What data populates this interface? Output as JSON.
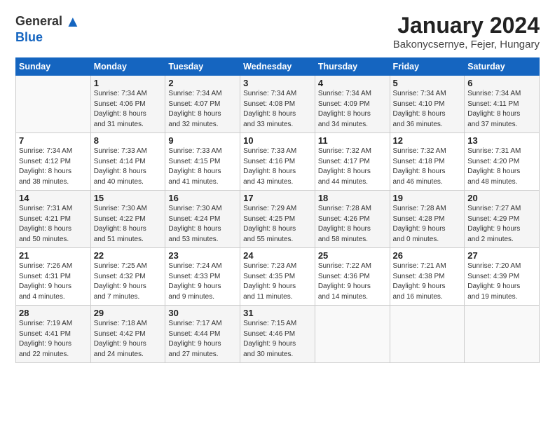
{
  "logo": {
    "general": "General",
    "blue": "Blue"
  },
  "header": {
    "month": "January 2024",
    "location": "Bakonycsernye, Fejer, Hungary"
  },
  "weekdays": [
    "Sunday",
    "Monday",
    "Tuesday",
    "Wednesday",
    "Thursday",
    "Friday",
    "Saturday"
  ],
  "weeks": [
    [
      {
        "day": "",
        "info": ""
      },
      {
        "day": "1",
        "info": "Sunrise: 7:34 AM\nSunset: 4:06 PM\nDaylight: 8 hours\nand 31 minutes."
      },
      {
        "day": "2",
        "info": "Sunrise: 7:34 AM\nSunset: 4:07 PM\nDaylight: 8 hours\nand 32 minutes."
      },
      {
        "day": "3",
        "info": "Sunrise: 7:34 AM\nSunset: 4:08 PM\nDaylight: 8 hours\nand 33 minutes."
      },
      {
        "day": "4",
        "info": "Sunrise: 7:34 AM\nSunset: 4:09 PM\nDaylight: 8 hours\nand 34 minutes."
      },
      {
        "day": "5",
        "info": "Sunrise: 7:34 AM\nSunset: 4:10 PM\nDaylight: 8 hours\nand 36 minutes."
      },
      {
        "day": "6",
        "info": "Sunrise: 7:34 AM\nSunset: 4:11 PM\nDaylight: 8 hours\nand 37 minutes."
      }
    ],
    [
      {
        "day": "7",
        "info": "Sunrise: 7:34 AM\nSunset: 4:12 PM\nDaylight: 8 hours\nand 38 minutes."
      },
      {
        "day": "8",
        "info": "Sunrise: 7:33 AM\nSunset: 4:14 PM\nDaylight: 8 hours\nand 40 minutes."
      },
      {
        "day": "9",
        "info": "Sunrise: 7:33 AM\nSunset: 4:15 PM\nDaylight: 8 hours\nand 41 minutes."
      },
      {
        "day": "10",
        "info": "Sunrise: 7:33 AM\nSunset: 4:16 PM\nDaylight: 8 hours\nand 43 minutes."
      },
      {
        "day": "11",
        "info": "Sunrise: 7:32 AM\nSunset: 4:17 PM\nDaylight: 8 hours\nand 44 minutes."
      },
      {
        "day": "12",
        "info": "Sunrise: 7:32 AM\nSunset: 4:18 PM\nDaylight: 8 hours\nand 46 minutes."
      },
      {
        "day": "13",
        "info": "Sunrise: 7:31 AM\nSunset: 4:20 PM\nDaylight: 8 hours\nand 48 minutes."
      }
    ],
    [
      {
        "day": "14",
        "info": "Sunrise: 7:31 AM\nSunset: 4:21 PM\nDaylight: 8 hours\nand 50 minutes."
      },
      {
        "day": "15",
        "info": "Sunrise: 7:30 AM\nSunset: 4:22 PM\nDaylight: 8 hours\nand 51 minutes."
      },
      {
        "day": "16",
        "info": "Sunrise: 7:30 AM\nSunset: 4:24 PM\nDaylight: 8 hours\nand 53 minutes."
      },
      {
        "day": "17",
        "info": "Sunrise: 7:29 AM\nSunset: 4:25 PM\nDaylight: 8 hours\nand 55 minutes."
      },
      {
        "day": "18",
        "info": "Sunrise: 7:28 AM\nSunset: 4:26 PM\nDaylight: 8 hours\nand 58 minutes."
      },
      {
        "day": "19",
        "info": "Sunrise: 7:28 AM\nSunset: 4:28 PM\nDaylight: 9 hours\nand 0 minutes."
      },
      {
        "day": "20",
        "info": "Sunrise: 7:27 AM\nSunset: 4:29 PM\nDaylight: 9 hours\nand 2 minutes."
      }
    ],
    [
      {
        "day": "21",
        "info": "Sunrise: 7:26 AM\nSunset: 4:31 PM\nDaylight: 9 hours\nand 4 minutes."
      },
      {
        "day": "22",
        "info": "Sunrise: 7:25 AM\nSunset: 4:32 PM\nDaylight: 9 hours\nand 7 minutes."
      },
      {
        "day": "23",
        "info": "Sunrise: 7:24 AM\nSunset: 4:33 PM\nDaylight: 9 hours\nand 9 minutes."
      },
      {
        "day": "24",
        "info": "Sunrise: 7:23 AM\nSunset: 4:35 PM\nDaylight: 9 hours\nand 11 minutes."
      },
      {
        "day": "25",
        "info": "Sunrise: 7:22 AM\nSunset: 4:36 PM\nDaylight: 9 hours\nand 14 minutes."
      },
      {
        "day": "26",
        "info": "Sunrise: 7:21 AM\nSunset: 4:38 PM\nDaylight: 9 hours\nand 16 minutes."
      },
      {
        "day": "27",
        "info": "Sunrise: 7:20 AM\nSunset: 4:39 PM\nDaylight: 9 hours\nand 19 minutes."
      }
    ],
    [
      {
        "day": "28",
        "info": "Sunrise: 7:19 AM\nSunset: 4:41 PM\nDaylight: 9 hours\nand 22 minutes."
      },
      {
        "day": "29",
        "info": "Sunrise: 7:18 AM\nSunset: 4:42 PM\nDaylight: 9 hours\nand 24 minutes."
      },
      {
        "day": "30",
        "info": "Sunrise: 7:17 AM\nSunset: 4:44 PM\nDaylight: 9 hours\nand 27 minutes."
      },
      {
        "day": "31",
        "info": "Sunrise: 7:15 AM\nSunset: 4:46 PM\nDaylight: 9 hours\nand 30 minutes."
      },
      {
        "day": "",
        "info": ""
      },
      {
        "day": "",
        "info": ""
      },
      {
        "day": "",
        "info": ""
      }
    ]
  ]
}
